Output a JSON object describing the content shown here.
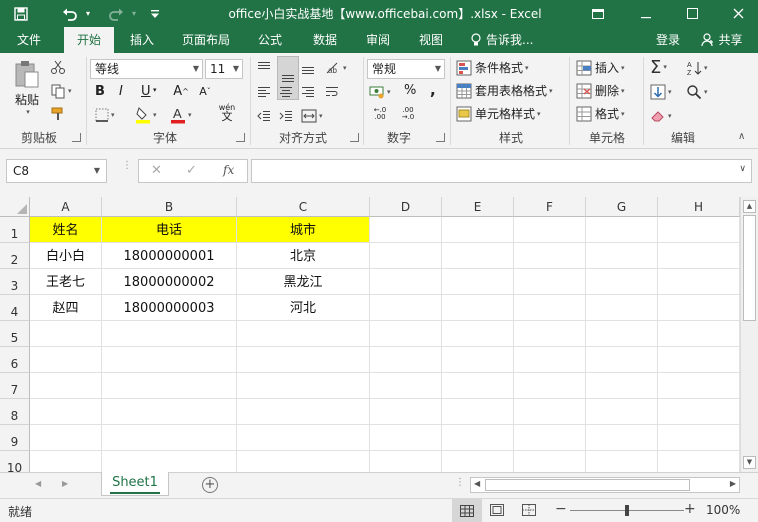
{
  "window": {
    "title": "office小白实战基地【www.officebai.com】.xlsx - Excel",
    "qat_icons": [
      "save-icon",
      "undo-icon",
      "redo-icon",
      "customize-icon"
    ]
  },
  "tabs": [
    {
      "label": "文件",
      "active": false
    },
    {
      "label": "开始",
      "active": true
    },
    {
      "label": "插入",
      "active": false
    },
    {
      "label": "页面布局",
      "active": false
    },
    {
      "label": "公式",
      "active": false
    },
    {
      "label": "数据",
      "active": false
    },
    {
      "label": "审阅",
      "active": false
    },
    {
      "label": "视图",
      "active": false
    }
  ],
  "tell_me": "告诉我...",
  "login": "登录",
  "share": "共享",
  "ribbon": {
    "clipboard": {
      "paste": "粘贴",
      "label": "剪贴板"
    },
    "font": {
      "name": "等线",
      "size": "11",
      "bold": "B",
      "italic": "I",
      "underline": "U",
      "wen": "wén",
      "label": "字体"
    },
    "alignment": {
      "label": "对齐方式"
    },
    "number": {
      "format": "常规",
      "percent": "%",
      "comma": ",",
      "label": "数字"
    },
    "styles": {
      "conditional": "条件格式",
      "table": "套用表格格式",
      "cell_styles": "单元格样式",
      "label": "样式"
    },
    "cells": {
      "insert": "插入",
      "delete": "删除",
      "format": "格式",
      "label": "单元格"
    },
    "editing": {
      "label": "编辑"
    }
  },
  "formula_bar": {
    "name_box": "C8",
    "fx": "fx",
    "cancel": "✕",
    "enter": "✓",
    "value": ""
  },
  "grid": {
    "columns": [
      "A",
      "B",
      "C",
      "D",
      "E",
      "F",
      "G",
      "H"
    ],
    "rows": [
      "1",
      "2",
      "3",
      "4",
      "5",
      "6",
      "7",
      "8",
      "9",
      "10"
    ],
    "header_fill": "#ffff00",
    "data": [
      [
        "姓名",
        "电话",
        "城市"
      ],
      [
        "白小白",
        "18000000001",
        "北京"
      ],
      [
        "王老七",
        "18000000002",
        "黑龙江"
      ],
      [
        "赵四",
        "18000000003",
        "河北"
      ]
    ]
  },
  "sheets": [
    {
      "name": "Sheet1",
      "active": true
    }
  ],
  "status": {
    "ready": "就绪",
    "zoom": "100%"
  },
  "colors": {
    "excel_green": "#217346",
    "ribbon_bg": "#f3f3f3"
  }
}
